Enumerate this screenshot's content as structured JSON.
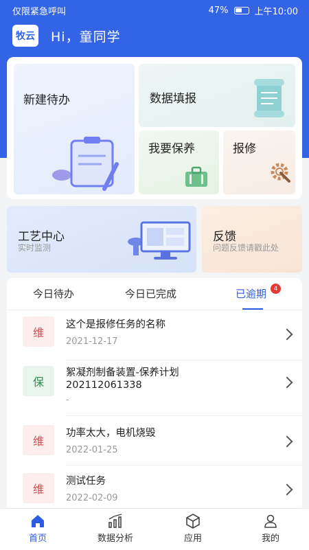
{
  "status_bar": {
    "left_text": "仅限紧急呼叫",
    "battery": "47%",
    "time": "上午10:00"
  },
  "header": {
    "logo": "牧云",
    "greeting": "Hi，童同学"
  },
  "tiles": {
    "new_todo": "新建待办",
    "data_report": "数据填报",
    "maintenance_request": "我要保养",
    "repair": "报修"
  },
  "wide_cards": {
    "process_center": {
      "title": "工艺中心",
      "subtitle": "实时监测"
    },
    "feedback": {
      "title": "反馈",
      "subtitle": "问题反馈请戳此处"
    }
  },
  "tabs": {
    "items": [
      "今日待办",
      "今日已完成",
      "已逾期"
    ],
    "active_index": 2,
    "overdue_badge": "4"
  },
  "tasks": [
    {
      "tag": "维",
      "tag_color": "red",
      "title": "这个是报修任务的名称",
      "date": "2021-12-17"
    },
    {
      "tag": "保",
      "tag_color": "green",
      "title": "絮凝剂制备装置-保养计划202112061338",
      "date": "-"
    },
    {
      "tag": "维",
      "tag_color": "red",
      "title": "功率太大，电机烧毁",
      "date": "2022-01-25"
    },
    {
      "tag": "维",
      "tag_color": "red",
      "title": "测试任务",
      "date": "2022-02-09"
    }
  ],
  "nav": {
    "items": [
      "首页",
      "数据分析",
      "应用",
      "我的"
    ],
    "active_index": 0
  },
  "colors": {
    "primary": "#3464e6",
    "accent_blue": "#2d5be3",
    "badge_red": "#e53935"
  }
}
